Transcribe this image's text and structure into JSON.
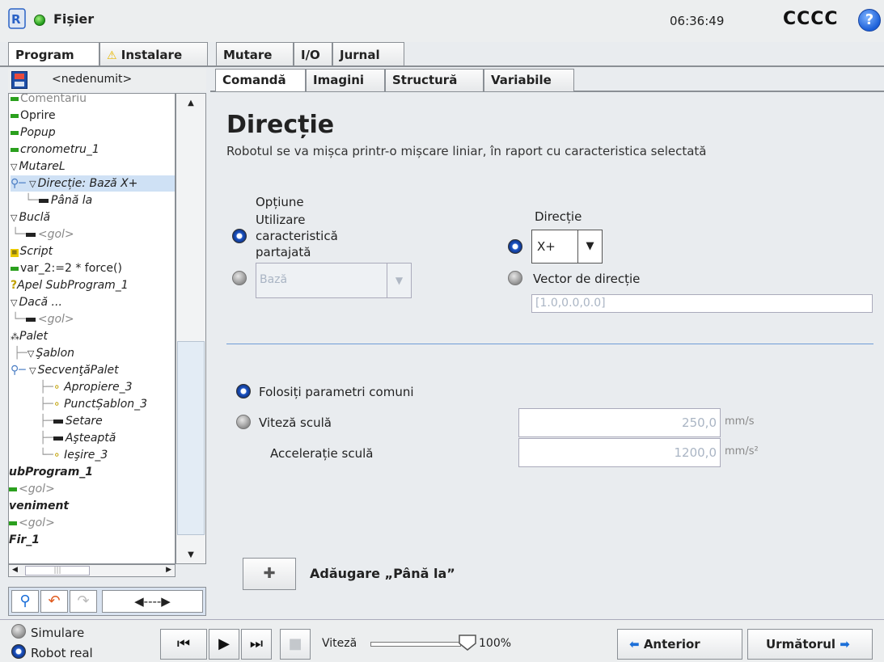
{
  "header": {
    "file_label": "Fișier",
    "clock": "06:36:49",
    "robot_name": "CCCC",
    "help": "?"
  },
  "main_tabs": [
    {
      "label": "Program",
      "active": true
    },
    {
      "label": "Instalare",
      "warning": "⚠"
    },
    {
      "label": "Mutare"
    },
    {
      "label": "I/O"
    },
    {
      "label": "Jurnal"
    }
  ],
  "program": {
    "name": "<nedenumit>"
  },
  "tree": {
    "items": [
      {
        "label": "Comentariu"
      },
      {
        "label": "Oprire"
      },
      {
        "label": "Popup"
      },
      {
        "label": "cronometru_1"
      },
      {
        "label": "MutareL"
      },
      {
        "label": "Direcție: Bază X+"
      },
      {
        "label": "Până la"
      },
      {
        "label": "Buclă"
      },
      {
        "label": "<gol>"
      },
      {
        "label": "Script"
      },
      {
        "label": "var_2:=2 * force()"
      },
      {
        "label": "Apel SubProgram_1"
      },
      {
        "label": "Dacă ..."
      },
      {
        "label": "<gol>"
      },
      {
        "label": "Palet"
      },
      {
        "label": "Şablon"
      },
      {
        "label": "SecvenţăPalet"
      },
      {
        "label": "Apropiere_3"
      },
      {
        "label": "PunctȘablon_3"
      },
      {
        "label": "Setare"
      },
      {
        "label": "Aşteaptă"
      },
      {
        "label": "Ieşire_3"
      },
      {
        "label": "ubProgram_1"
      },
      {
        "label": "<gol>"
      },
      {
        "label": "veniment"
      },
      {
        "label": "<gol>"
      },
      {
        "label": "Fir_1"
      }
    ],
    "hscroll_mark": "|||"
  },
  "sub_tabs": [
    {
      "label": "Comandă",
      "active": true
    },
    {
      "label": "Imagini"
    },
    {
      "label": "Structură"
    },
    {
      "label": "Variabile"
    }
  ],
  "direction": {
    "title": "Direcție",
    "subtitle": "Robotul se va mișca printr-o mișcare liniar, în raport cu caracteristica selectată",
    "option_heading": "Opțiune",
    "use_shared_line1": "Utilizare",
    "use_shared_line2": "caracteristică",
    "use_shared_line3": "partajată",
    "feature_value": "Bază",
    "direction_heading": "Direcție",
    "direction_value": "X+",
    "vector_label": "Vector de direcție",
    "vector_value": "[1.0,0.0,0.0]"
  },
  "params": {
    "common_label": "Folosiți parametri comuni",
    "tool_speed_label": "Viteză sculă",
    "tool_speed_value": "250,0",
    "tool_speed_unit": "mm/s",
    "tool_accel_label": "Accelerație sculă",
    "tool_accel_value": "1200,0",
    "tool_accel_unit": "mm/s²"
  },
  "add_until": {
    "label": "Adăugare „Până la”"
  },
  "bottom": {
    "simulation_label": "Simulare",
    "real_robot_label": "Robot real",
    "speed_label": "Viteză",
    "speed_value": "100%",
    "prev_label": "Anterior",
    "next_label": "Următorul"
  },
  "colors": {
    "accent_blue": "#1f57c8",
    "tab_border": "#8a8f95",
    "divider": "#6f9cd6"
  }
}
